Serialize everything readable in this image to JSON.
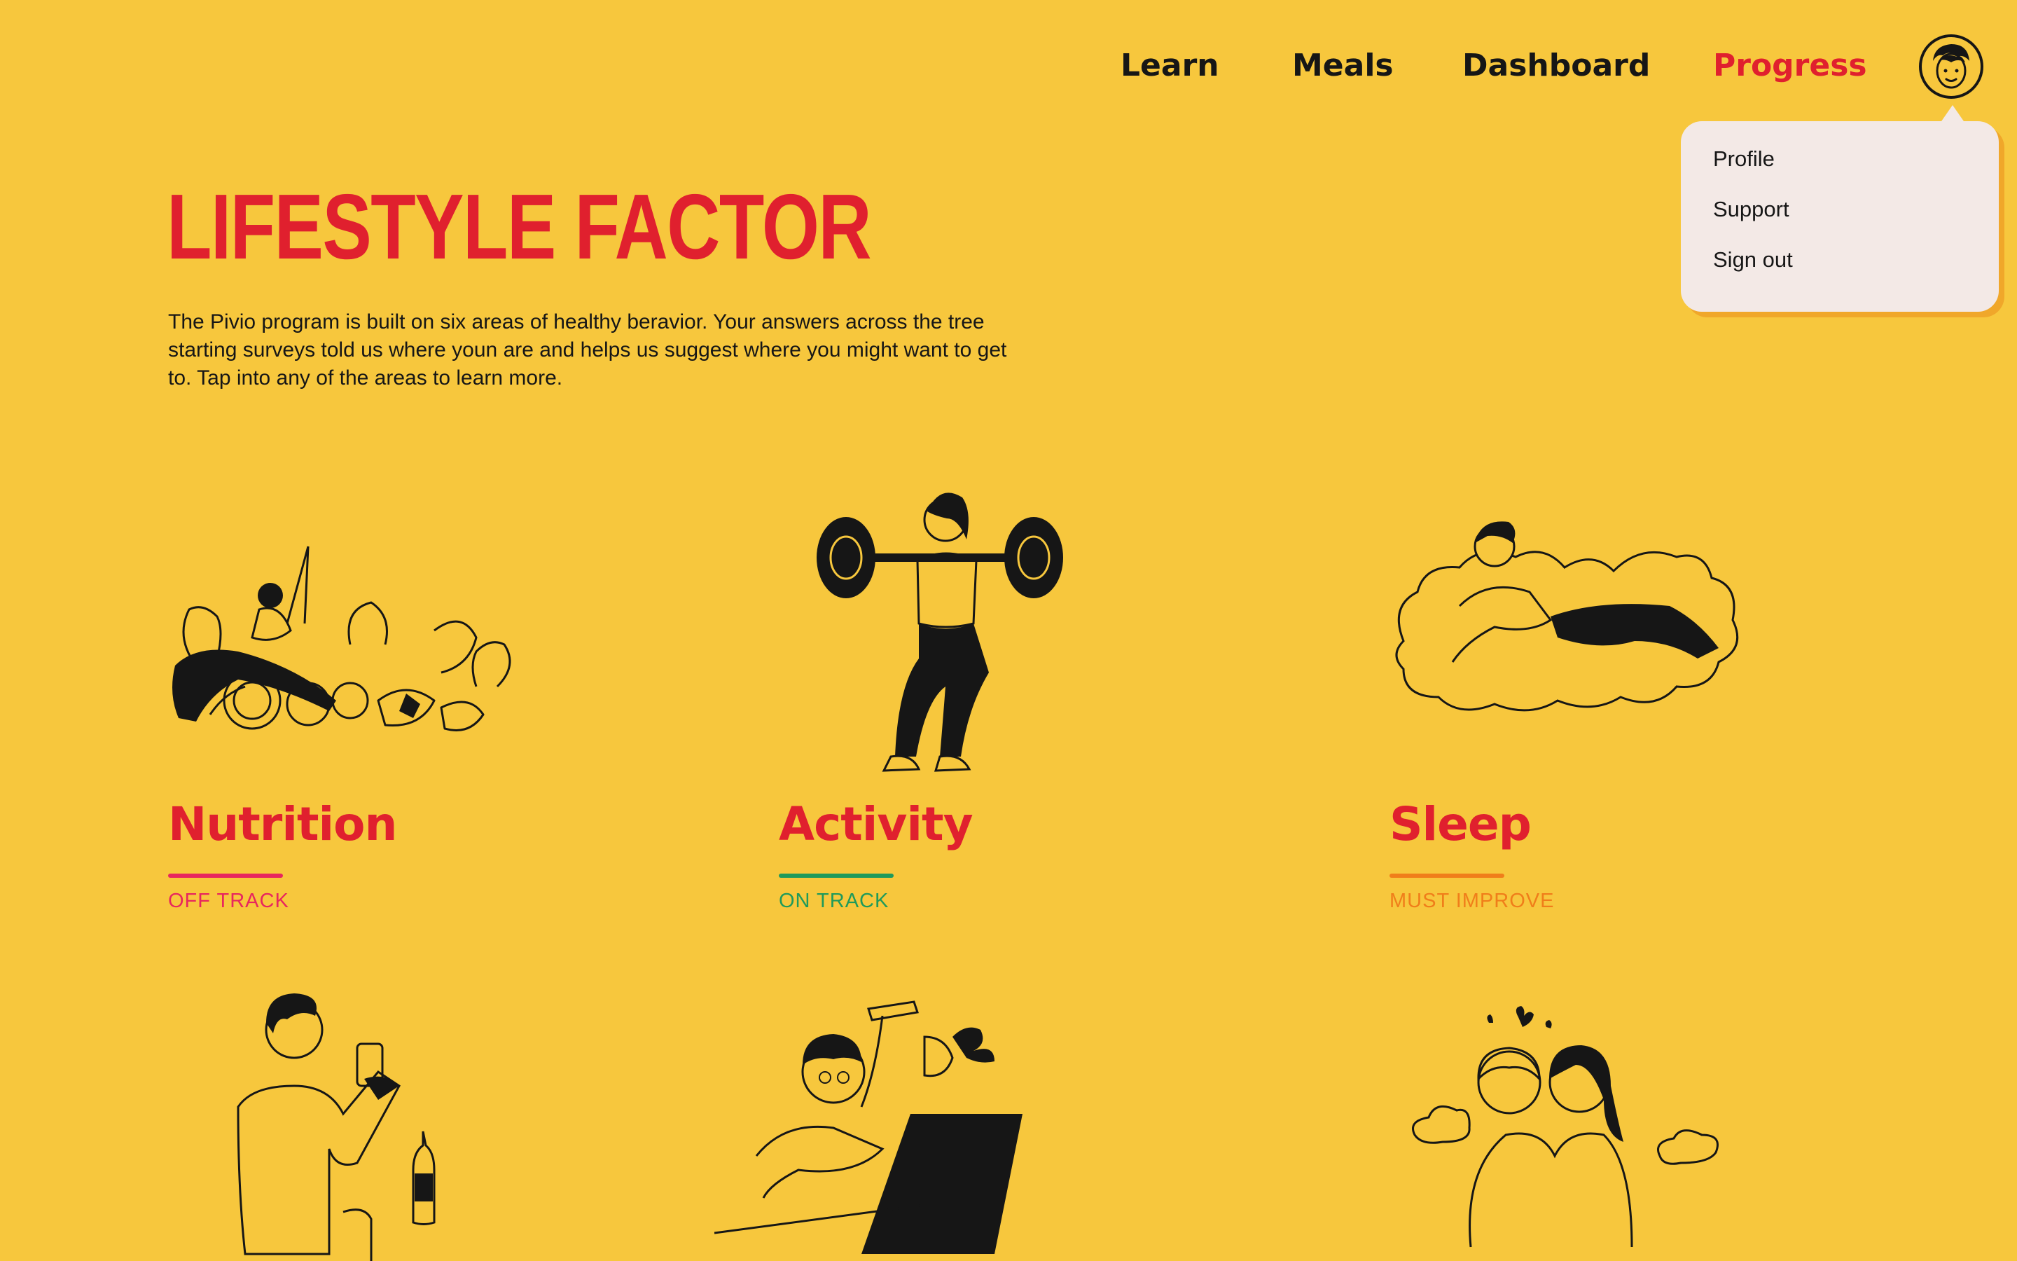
{
  "nav": {
    "items": [
      {
        "label": "Learn",
        "active": false
      },
      {
        "label": "Meals",
        "active": false
      },
      {
        "label": "Dashboard",
        "active": false
      },
      {
        "label": "Progress",
        "active": true
      }
    ],
    "avatar_icon": "user-avatar-icon"
  },
  "dropdown": {
    "items": [
      "Profile",
      "Support",
      "Sign out"
    ]
  },
  "header": {
    "title": "LIFESTYLE FACTOR",
    "intro": "The Pivio program is  built on six areas of healthy beravior. Your answers across the tree starting surveys told us where youn are and helps us suggest where you might want to get to. Tap into any of the areas to learn more."
  },
  "factors": [
    {
      "name": "Nutrition",
      "status": "OFF TRACK",
      "status_color": "#E8265E",
      "illustration": "nutrition-yoga-vegetables-illustration"
    },
    {
      "name": "Activity",
      "status": "ON TRACK",
      "status_color": "#1F9A5B",
      "illustration": "activity-squat-barbell-illustration"
    },
    {
      "name": "Sleep",
      "status": "MUST IMPROVE",
      "status_color": "#F07E1A",
      "illustration": "sleep-cloud-illustration"
    },
    {
      "name": "",
      "status": "",
      "status_color": "",
      "illustration": "drinking-illustration"
    },
    {
      "name": "",
      "status": "",
      "status_color": "",
      "illustration": "stress-laptop-illustration"
    },
    {
      "name": "",
      "status": "",
      "status_color": "",
      "illustration": "relationships-couple-illustration"
    }
  ],
  "colors": {
    "background": "#F7C73D",
    "accent": "#E0202E",
    "dropdown_bg": "#F3E9E6",
    "text": "#161616"
  }
}
